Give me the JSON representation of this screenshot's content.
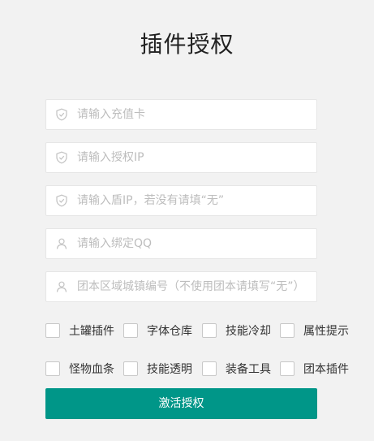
{
  "page": {
    "title": "插件授权"
  },
  "fields": [
    {
      "icon": "shield-check-icon",
      "placeholder": "请输入充值卡",
      "value": ""
    },
    {
      "icon": "shield-check-icon",
      "placeholder": "请输入授权IP",
      "value": ""
    },
    {
      "icon": "shield-check-icon",
      "placeholder": "请输入盾IP，若没有请填“无”",
      "value": ""
    },
    {
      "icon": "user-icon",
      "placeholder": "请输入绑定QQ",
      "value": ""
    },
    {
      "icon": "user-icon",
      "placeholder": "团本区域城镇编号（不使用团本请填写“无”）",
      "value": ""
    }
  ],
  "options_row1": [
    {
      "label": "土罐插件",
      "checked": false
    },
    {
      "label": "字体仓库",
      "checked": false
    },
    {
      "label": "技能冷却",
      "checked": false
    },
    {
      "label": "属性提示",
      "checked": false
    }
  ],
  "options_row2": [
    {
      "label": "怪物血条",
      "checked": false
    },
    {
      "label": "技能透明",
      "checked": false
    },
    {
      "label": "装备工具",
      "checked": false
    },
    {
      "label": "团本插件",
      "checked": false
    }
  ],
  "submit": {
    "label": "激活授权"
  },
  "colors": {
    "accent": "#009688",
    "background": "#f2f2f2",
    "icon": "#c2c2c2"
  }
}
